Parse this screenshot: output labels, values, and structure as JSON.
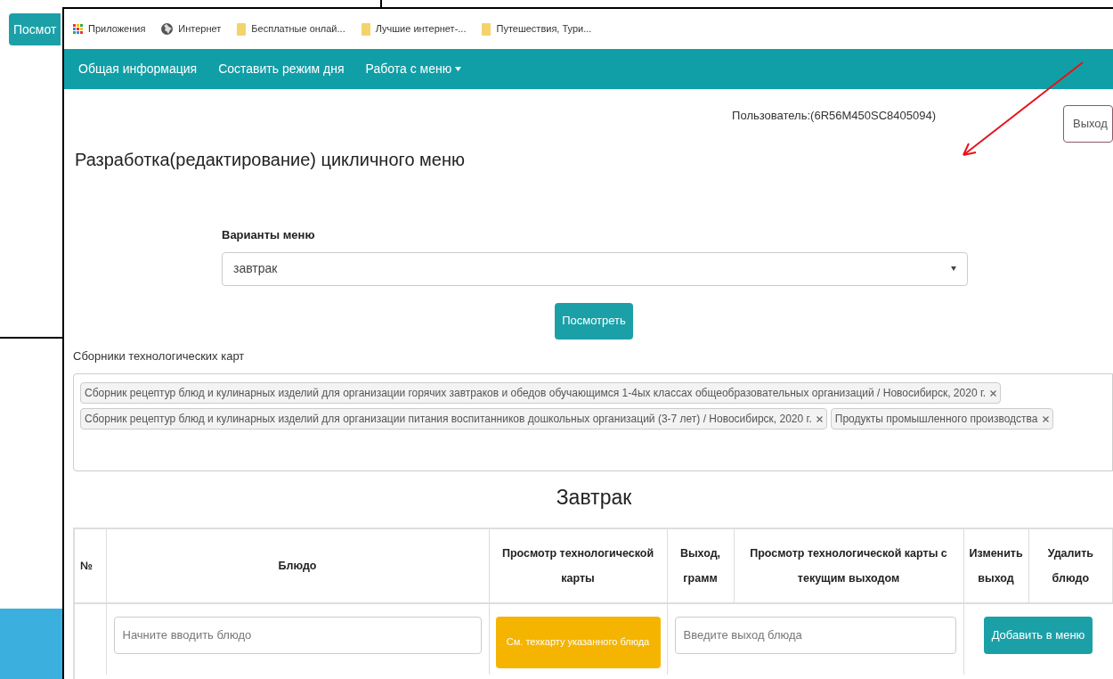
{
  "background_window": {
    "button": "Посмот"
  },
  "bookmarks": [
    {
      "label": "Приложения",
      "kind": "apps"
    },
    {
      "label": "Интернет",
      "kind": "globe"
    },
    {
      "label": "Бесплатные онлай...",
      "kind": "folder"
    },
    {
      "label": "Лучшие интернет-...",
      "kind": "folder"
    },
    {
      "label": "Путешествия, Тури...",
      "kind": "folder"
    }
  ],
  "nav": [
    {
      "label": "Общая информация",
      "dropdown": false
    },
    {
      "label": "Составить режим дня",
      "dropdown": false
    },
    {
      "label": "Работа с меню",
      "dropdown": true
    }
  ],
  "user": "Пользователь:(6R56M450SC8405094)",
  "logout_button": "Выход",
  "title": "Разработка(редактирование) цикличного меню",
  "menu_variant": {
    "label": "Варианты меню",
    "value": "завтрак"
  },
  "view_button": "Посмотреть",
  "collections": {
    "label": "Сборники технологических карт",
    "tags": [
      "Сборник рецептур блюд и кулинарных изделий для организации горячих завтраков и обедов обучающимся 1-4ых классах общеобразовательных организаций / Новосибирск, 2020 г.",
      "Сборник рецептур блюд и кулинарных изделий для организации питания воспитанников дошкольных организаций (3-7 лет) / Новосибирск, 2020 г.",
      "Продукты промышленного производства"
    ]
  },
  "section_title": "Завтрак",
  "table": {
    "columns": [
      "№",
      "Блюдо",
      "Просмотр технологической карты",
      "Выход, грамм",
      "Просмотр технологической карты с текущим выходом",
      "Изменить выход",
      "Удалить блюдо"
    ],
    "row": {
      "dish_placeholder": "Начните вводить блюдо",
      "techcard_button": "См. техкарту указанного блюда",
      "yield_placeholder": "Введите выход блюда",
      "add_button": "Добавить в меню"
    }
  }
}
